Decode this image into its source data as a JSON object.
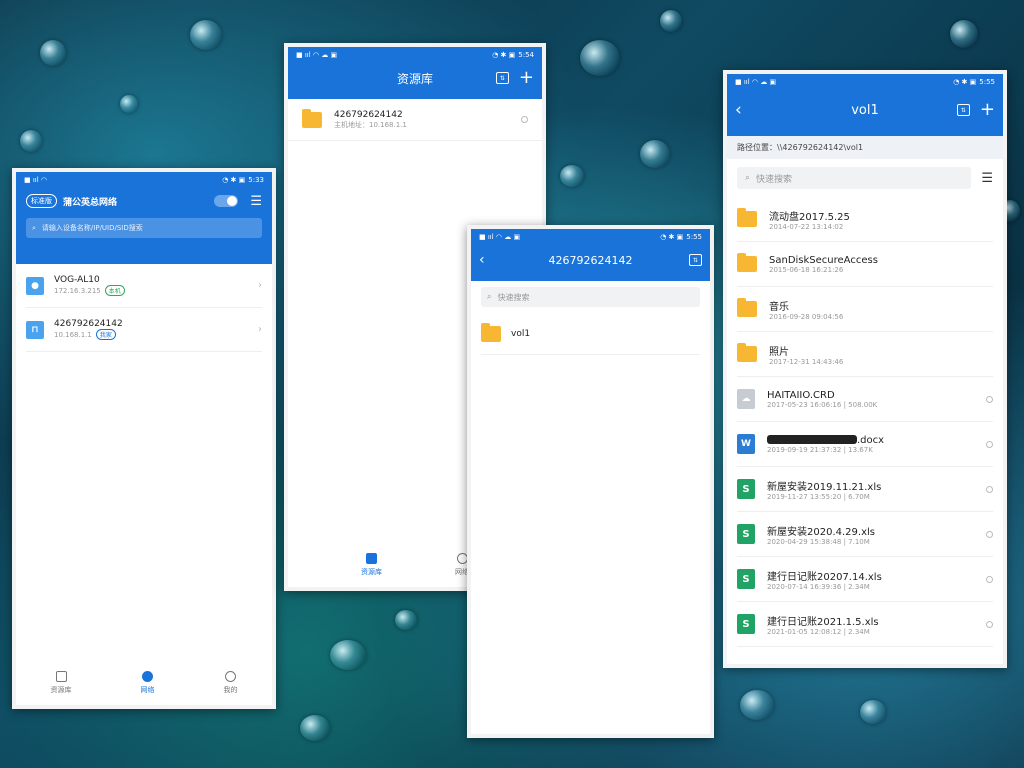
{
  "status": {
    "p1_time": "5:33",
    "p2_time": "5:54",
    "p3_time": "5:55",
    "p4_time": "5:55"
  },
  "phone1": {
    "badge": "标准版",
    "title": "蒲公英总网络",
    "search_placeholder": "请输入设备名称/IP/UID/SID搜索",
    "devices": [
      {
        "name": "VOG-AL10",
        "ip": "172.16.3.215",
        "tag": "本机"
      },
      {
        "name": "426792624142",
        "ip": "10.168.1.1",
        "tag": "我家"
      }
    ],
    "tabs": [
      "资源库",
      "网络",
      "我的"
    ],
    "active_tab": "网络"
  },
  "phone2": {
    "title": "资源库",
    "item": {
      "name": "426792624142",
      "addr": "主机地址：10.168.1.1"
    },
    "tabs": [
      "资源库",
      "网络"
    ]
  },
  "phone3": {
    "title": "426792624142",
    "search_placeholder": "快速搜索",
    "folder": "vol1"
  },
  "phone4": {
    "title": "vol1",
    "path": "路径位置：\\\\426792624142\\vol1",
    "search_placeholder": "快速搜索",
    "files": [
      {
        "name": "流动盘2017.5.25",
        "date": "2014-07-22 13:14:02",
        "size": "",
        "type": "folder"
      },
      {
        "name": "SanDiskSecureAccess",
        "date": "2015-06-18 16:21:26",
        "size": "",
        "type": "folder"
      },
      {
        "name": "音乐",
        "date": "2016-09-28 09:04:56",
        "size": "",
        "type": "folder"
      },
      {
        "name": "照片",
        "date": "2017-12-31 14:43:46",
        "size": "",
        "type": "folder"
      },
      {
        "name": "HAITAIIO.CRD",
        "date": "2017-05-23 16:06:16",
        "size": "508.00K",
        "type": "file"
      },
      {
        "name": ".docx",
        "date": "2019-09-19 21:37:32",
        "size": "13.67K",
        "type": "docx"
      },
      {
        "name": "新屋安装2019.11.21.xls",
        "date": "2019-11-27 13:55:20",
        "size": "6.70M",
        "type": "xls"
      },
      {
        "name": "新屋安装2020.4.29.xls",
        "date": "2020-04-29 15:38:48",
        "size": "7.10M",
        "type": "xls"
      },
      {
        "name": "建行日记账20207.14.xls",
        "date": "2020-07-14 16:39:36",
        "size": "2.34M",
        "type": "xls"
      },
      {
        "name": "建行日记账2021.1.5.xls",
        "date": "2021-01-05 12:08:12",
        "size": "2.34M",
        "type": "xls"
      }
    ]
  },
  "colors": {
    "accent": "#1a73d9",
    "folder": "#f7b733",
    "xls": "#21a366",
    "docx": "#2b7cd3"
  }
}
